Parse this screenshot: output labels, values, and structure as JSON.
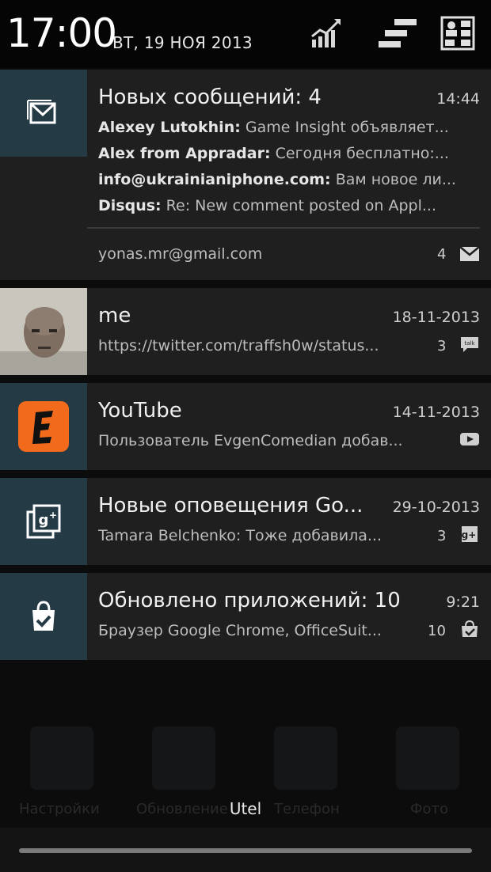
{
  "statusbar": {
    "time": "17:00",
    "date": "ВТ, 19 НОЯ 2013"
  },
  "notifications": [
    {
      "icon": "gmail-icon",
      "title": "Новых сообщений: 4",
      "time": "14:44",
      "lines": [
        {
          "sender": "Alexey Lutokhin:",
          "text": " Game Insight объявляет..."
        },
        {
          "sender": "Alex from Appradar:",
          "text": " Сегодня бесплатно:..."
        },
        {
          "sender": "info@ukrainianiphone.com:",
          "text": " Вам новое ли..."
        },
        {
          "sender": "Disqus:",
          "text": " Re: New comment posted on Appl..."
        }
      ],
      "account": "yonas.mr@gmail.com",
      "count": "4"
    },
    {
      "icon": "avatar",
      "title": "me",
      "time": "18-11-2013",
      "text": "https://twitter.com/traffsh0w/status...",
      "count": "3",
      "small_icon": "talk-icon"
    },
    {
      "icon": "youtube-user-icon",
      "title": "YouTube",
      "time": "14-11-2013",
      "text": "Пользователь EvgenComedian добав...",
      "small_icon": "youtube-icon"
    },
    {
      "icon": "google-plus-icon",
      "title": "Новые оповещения Go...",
      "time": "29-10-2013",
      "text": "Tamara Belchenko: Тоже добавила...",
      "count": "3",
      "small_icon": "google-plus-small-icon"
    },
    {
      "icon": "play-store-icon",
      "title": "Обновлено приложений: 10",
      "time": "9:21",
      "text": "Браузер Google Chrome, OfficeSuit...",
      "count": "10",
      "small_icon": "play-store-small-icon"
    }
  ],
  "background": {
    "labels": [
      "Настройки",
      "Обновление",
      "Телефон",
      "Фото"
    ]
  },
  "carrier": "Utel",
  "colors": {
    "icon_box": "#243a45",
    "card": "#1f1f1f",
    "youtube_orange": "#f26b1d"
  }
}
